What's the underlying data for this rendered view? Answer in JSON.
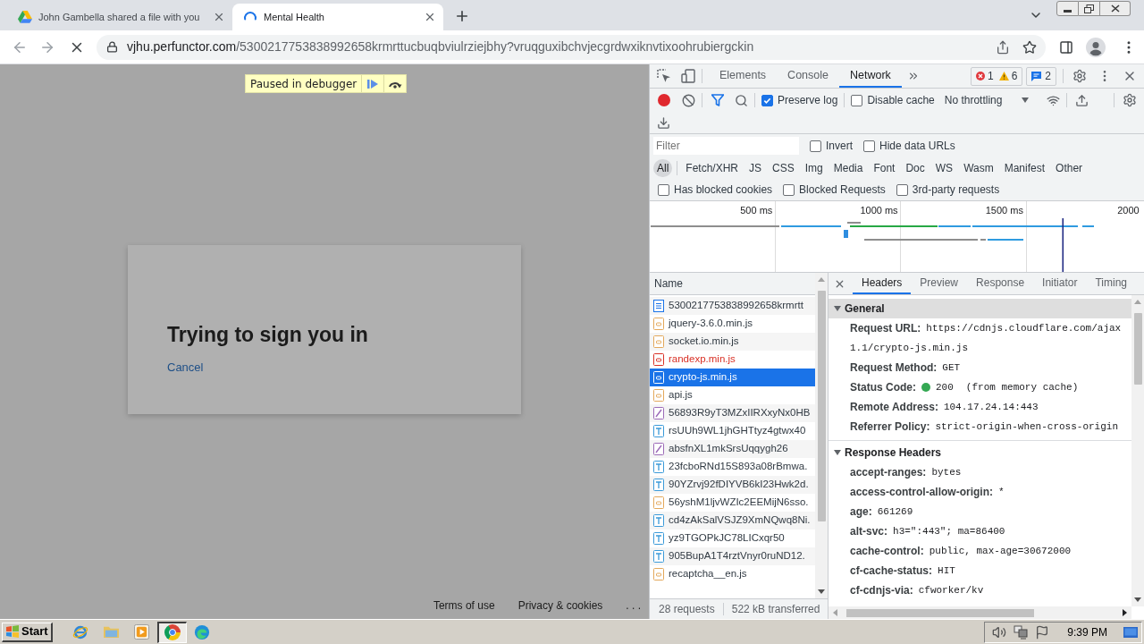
{
  "browser": {
    "tabs": [
      {
        "kind": "drive",
        "title": "John Gambella shared a file with you",
        "selected": false
      },
      {
        "kind": "loading",
        "title": "Mental Health",
        "selected": true
      }
    ],
    "loading": true,
    "url": {
      "domain": "vjhu.perfunctor.com",
      "path": "/5300217753838992658krmrttucbuqbviulrziejbhy?vruqguxibchvjecgrdwxiknvtixoohrubiergckin"
    }
  },
  "page": {
    "banner": "Paused in debugger",
    "dialog": {
      "title": "Trying to sign you in",
      "link": "Cancel"
    },
    "footer": [
      "Terms of use",
      "Privacy & cookies",
      ". . ."
    ]
  },
  "devtools": {
    "panels": [
      {
        "label": "Elements",
        "selected": false
      },
      {
        "label": "Console",
        "selected": false
      },
      {
        "label": "Network",
        "selected": true
      }
    ],
    "issues": {
      "errors": "1",
      "warnings": "6",
      "messages": "2"
    },
    "network": {
      "recording": true,
      "preserve_log": {
        "label": "Preserve log",
        "checked": true
      },
      "disable_cache": {
        "label": "Disable cache",
        "checked": false
      },
      "throttling": "No throttling",
      "filter": {
        "placeholder": "Filter"
      },
      "filter_options": [
        {
          "label": "Invert",
          "checked": false
        },
        {
          "label": "Hide data URLs",
          "checked": false
        }
      ],
      "types": [
        {
          "label": "All",
          "selected": true
        },
        {
          "label": "Fetch/XHR",
          "selected": false
        },
        {
          "label": "JS",
          "selected": false
        },
        {
          "label": "CSS",
          "selected": false
        },
        {
          "label": "Img",
          "selected": false
        },
        {
          "label": "Media",
          "selected": false
        },
        {
          "label": "Font",
          "selected": false
        },
        {
          "label": "Doc",
          "selected": false
        },
        {
          "label": "WS",
          "selected": false
        },
        {
          "label": "Wasm",
          "selected": false
        },
        {
          "label": "Manifest",
          "selected": false
        },
        {
          "label": "Other",
          "selected": false
        }
      ],
      "extra_options": [
        {
          "label": "Has blocked cookies",
          "checked": false
        },
        {
          "label": "Blocked Requests",
          "checked": false
        },
        {
          "label": "3rd-party requests",
          "checked": false
        }
      ],
      "timeline": {
        "ticks": [
          "500 ms",
          "1000 ms",
          "1500 ms",
          "2000"
        ]
      },
      "requests": {
        "column": "Name",
        "rows": [
          {
            "name": "5300217753838992658krmrtt",
            "kind": "document",
            "selected": false,
            "failed": false
          },
          {
            "name": "jquery-3.6.0.min.js",
            "kind": "script",
            "selected": false,
            "failed": false
          },
          {
            "name": "socket.io.min.js",
            "kind": "script",
            "selected": false,
            "failed": false
          },
          {
            "name": "randexp.min.js",
            "kind": "script",
            "selected": false,
            "failed": true
          },
          {
            "name": "crypto-js.min.js",
            "kind": "script",
            "selected": true,
            "failed": false
          },
          {
            "name": "api.js",
            "kind": "script",
            "selected": false,
            "failed": false
          },
          {
            "name": "56893R9yT3MZxIIRXxyNx0HB",
            "kind": "image",
            "selected": false,
            "failed": false
          },
          {
            "name": "rsUUh9WL1jhGHTtyz4gtwx40",
            "kind": "font",
            "selected": false,
            "failed": false
          },
          {
            "name": "absfnXL1mkSrsUqqygh26",
            "kind": "image",
            "selected": false,
            "failed": false
          },
          {
            "name": "23fcboRNd15S893a08rBmwa.",
            "kind": "font",
            "selected": false,
            "failed": false
          },
          {
            "name": "90YZrvj92fDIYVB6kI23Hwk2d.",
            "kind": "font",
            "selected": false,
            "failed": false
          },
          {
            "name": "56yshM1ljvWZIc2EEMijN6sso.",
            "kind": "script",
            "selected": false,
            "failed": false
          },
          {
            "name": "cd4zAkSalVSJZ9XmNQwq8Ni.",
            "kind": "font",
            "selected": false,
            "failed": false
          },
          {
            "name": "yz9TGOPkJC78LICxqr50",
            "kind": "font",
            "selected": false,
            "failed": false
          },
          {
            "name": "905BupA1T4rztVnyr0ruND12.",
            "kind": "font",
            "selected": false,
            "failed": false
          },
          {
            "name": "recaptcha__en.js",
            "kind": "script",
            "selected": false,
            "failed": false
          }
        ]
      },
      "summary": [
        "28 requests",
        "522 kB transferred"
      ],
      "details": {
        "tabs": [
          {
            "label": "Headers",
            "selected": true
          },
          {
            "label": "Preview",
            "selected": false
          },
          {
            "label": "Response",
            "selected": false
          },
          {
            "label": "Initiator",
            "selected": false
          },
          {
            "label": "Timing",
            "selected": false
          }
        ],
        "sections": [
          {
            "title": "General",
            "expanded": true,
            "focused": true,
            "rows": [
              {
                "kind": "url",
                "key": "Request URL:",
                "lines": [
                  "https://cdnjs.cloudflare.com/ajax",
                  "1.1/crypto-js.min.js"
                ]
              },
              {
                "kind": "plain",
                "key": "Request Method:",
                "value": "GET"
              },
              {
                "kind": "status",
                "key": "Status Code:",
                "color": "#34a853",
                "value": "200",
                "note": "(from memory cache)"
              },
              {
                "kind": "plain",
                "key": "Remote Address:",
                "value": "104.17.24.14:443"
              },
              {
                "kind": "plain",
                "key": "Referrer Policy:",
                "value": "strict-origin-when-cross-origin"
              }
            ]
          },
          {
            "title": "Response Headers",
            "expanded": true,
            "focused": false,
            "rows": [
              {
                "kind": "plain",
                "key": "accept-ranges:",
                "value": "bytes"
              },
              {
                "kind": "plain",
                "key": "access-control-allow-origin:",
                "value": "*"
              },
              {
                "kind": "plain",
                "key": "age:",
                "value": "661269"
              },
              {
                "kind": "plain",
                "key": "alt-svc:",
                "value": "h3=\":443\"; ma=86400"
              },
              {
                "kind": "plain",
                "key": "cache-control:",
                "value": "public, max-age=30672000"
              },
              {
                "kind": "plain",
                "key": "cf-cache-status:",
                "value": "HIT"
              },
              {
                "kind": "plain",
                "key": "cf-cdnjs-via:",
                "value": "cfworker/kv"
              }
            ]
          }
        ]
      }
    }
  },
  "taskbar": {
    "start": "Start",
    "apps": [
      {
        "kind": "ie",
        "selected": false
      },
      {
        "kind": "folder",
        "selected": false
      },
      {
        "kind": "media",
        "selected": false
      },
      {
        "kind": "chrome",
        "selected": true
      },
      {
        "kind": "edge",
        "selected": false
      }
    ],
    "clock": "9:39 PM"
  }
}
